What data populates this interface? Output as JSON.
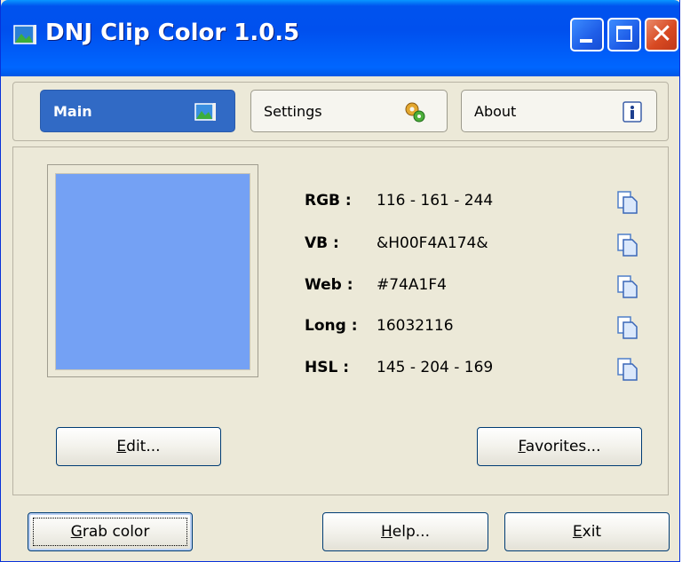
{
  "window": {
    "title": "DNJ Clip Color 1.0.5",
    "icon": "picture-icon"
  },
  "tabs": [
    {
      "label": "Main",
      "icon": "picture-icon",
      "active": true
    },
    {
      "label": "Settings",
      "icon": "settings-gears-icon",
      "active": false
    },
    {
      "label": "About",
      "icon": "info-icon",
      "active": false
    }
  ],
  "color": {
    "swatch_hex": "#74A1F4",
    "rows": [
      {
        "label": "RGB :",
        "value": "116 - 161 - 244"
      },
      {
        "label": "VB :",
        "value": "&H00F4A174&"
      },
      {
        "label": "Web :",
        "value": "#74A1F4"
      },
      {
        "label": "Long :",
        "value": "16032116"
      },
      {
        "label": "HSL :",
        "value": "145 - 204 - 169"
      }
    ]
  },
  "buttons": {
    "edit": {
      "mnemonic": "E",
      "rest": "dit..."
    },
    "favorites": {
      "mnemonic": "F",
      "rest": "avorites..."
    },
    "grab": {
      "mnemonic": "G",
      "rest": "rab color"
    },
    "help": {
      "mnemonic": "H",
      "rest": "elp..."
    },
    "exit": {
      "mnemonic": "E",
      "rest": "xit"
    }
  },
  "colors": {
    "title_bar": "#0058E6",
    "active_tab": "#316AC5",
    "window_bg": "#ECE9D8"
  }
}
